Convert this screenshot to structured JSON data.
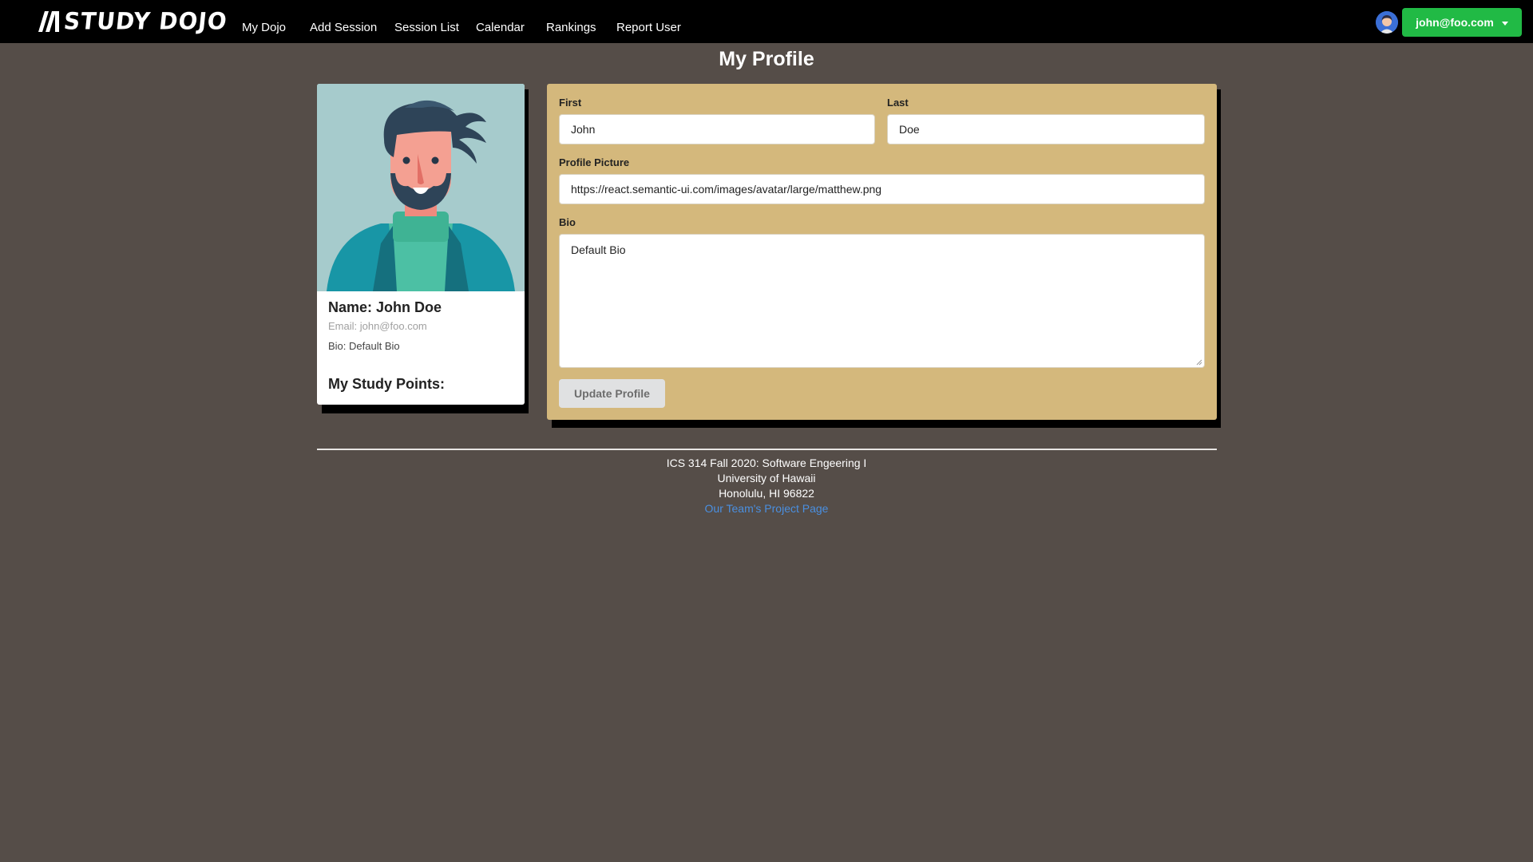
{
  "app": {
    "brand": "STUDY DOJO",
    "logo_icon": "slash-mark-logo"
  },
  "nav": {
    "items": [
      {
        "label": "My Dojo"
      },
      {
        "label": "Add Session"
      },
      {
        "label": "Session List"
      },
      {
        "label": "Calendar"
      },
      {
        "label": "Rankings"
      },
      {
        "label": "Report User"
      }
    ],
    "user_menu": {
      "label": "john@foo.com",
      "avatar_icon": "user-avatar-icon",
      "dropdown_icon": "caret-down-icon",
      "color": "#21ba45"
    }
  },
  "page": {
    "title": "My Profile"
  },
  "profile_card": {
    "name_prefix": "Name: ",
    "name": "John Doe",
    "email": "Email: john@foo.com",
    "bio": "Bio: Default Bio",
    "points_label": "My Study Points:"
  },
  "form": {
    "panel_color": "#d4b87c",
    "first": {
      "label": "First",
      "value": "John"
    },
    "last": {
      "label": "Last",
      "value": "Doe"
    },
    "picture": {
      "label": "Profile Picture",
      "value": "https://react.semantic-ui.com/images/avatar/large/matthew.png"
    },
    "bio": {
      "label": "Bio",
      "value": "Default Bio"
    },
    "submit_label": "Update Profile"
  },
  "footer": {
    "line1": "ICS 314 Fall 2020: Software Engeering I",
    "line2": "University of Hawaii",
    "line3": "Honolulu, HI 96822",
    "link": "Our Team's Project Page",
    "link_color": "#4a8fe0"
  }
}
